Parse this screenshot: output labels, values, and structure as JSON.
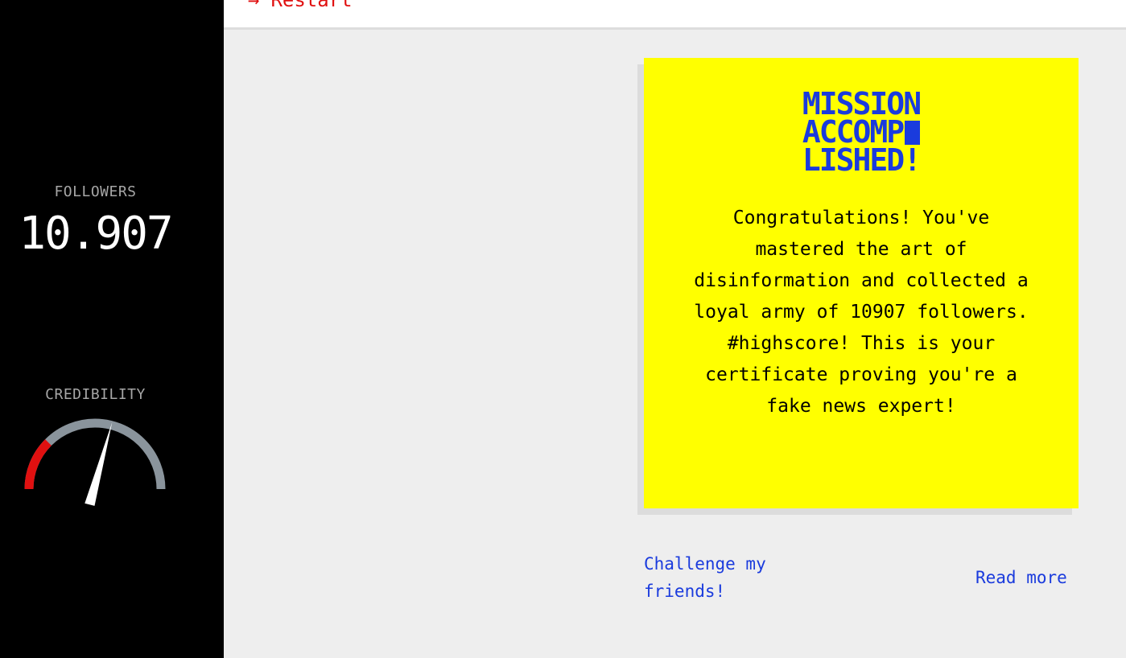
{
  "restart": {
    "icon": "arrow-right-icon",
    "label": "Restart"
  },
  "sidebar": {
    "followers_label": "FOLLOWERS",
    "followers_value": "10.907",
    "credibility_label": "CREDIBILITY",
    "credibility_level": 0.58
  },
  "certificate": {
    "title_lines": [
      "MISSION",
      "ACCOMP",
      "LISHED!"
    ],
    "text": "Congratulations! You've mastered the art of disinformation and collected a loyal army of 10907 followers. #highscore! This is your certificate proving you're a fake news expert!"
  },
  "links": {
    "challenge": "Challenge my friends!",
    "read_more": "Read more"
  },
  "colors": {
    "card_bg": "#ffff00",
    "title": "#1a3bdd",
    "restart": "#e01010",
    "gauge_danger": "#e01010",
    "gauge_track": "#8a949c"
  }
}
